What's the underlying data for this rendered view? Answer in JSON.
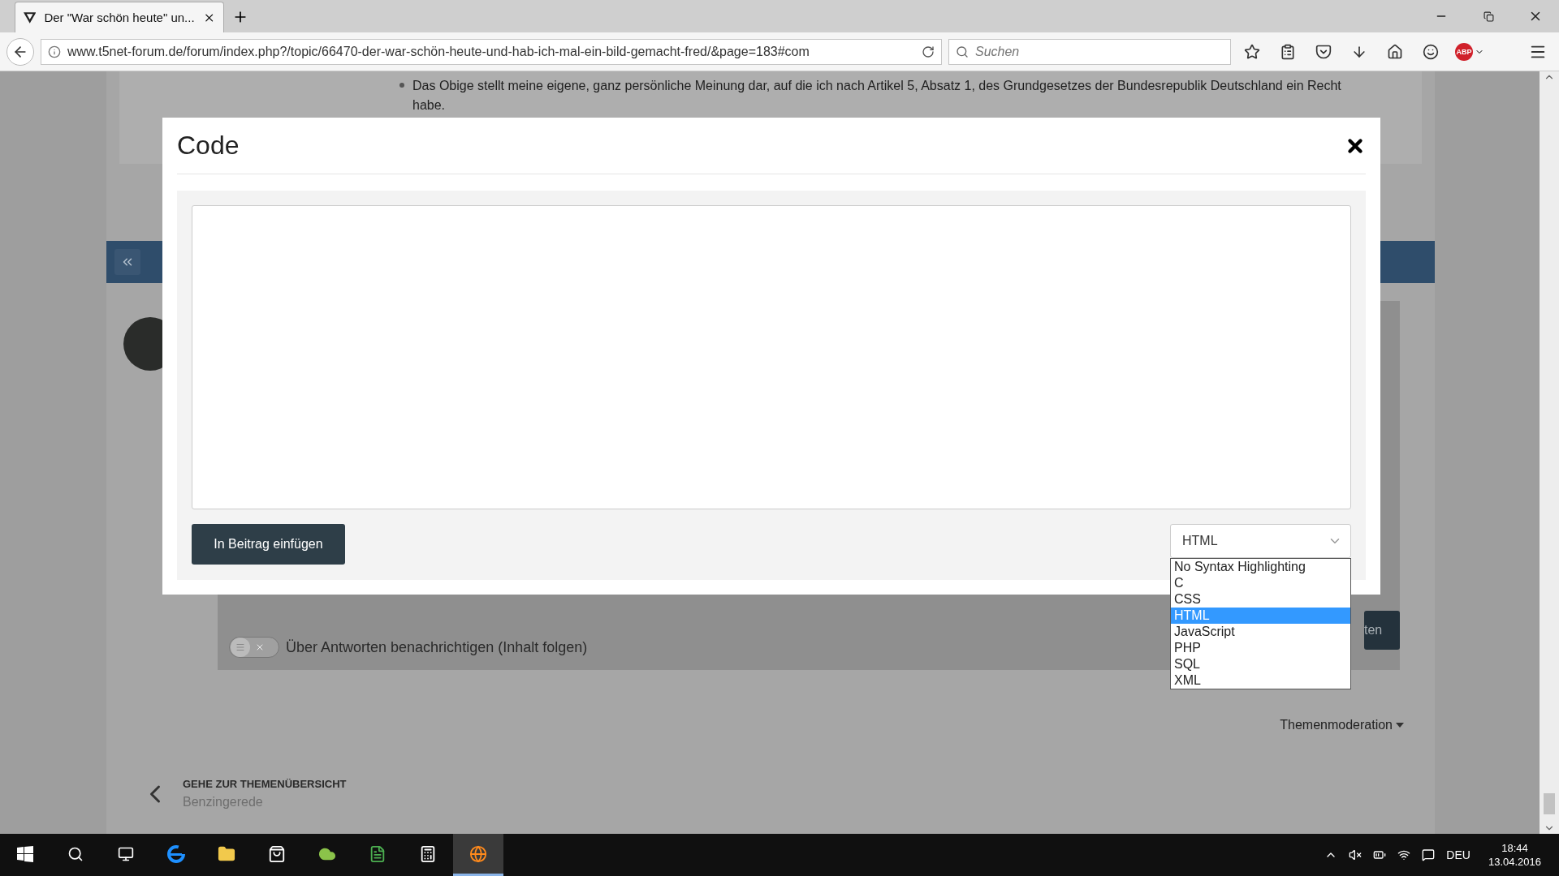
{
  "browser": {
    "tab": {
      "title": "Der \"War schön heute\" un...",
      "selected": true
    },
    "address": "www.t5net-forum.de/forum/index.php?/topic/66470-der-war-schön-heute-und-hab-ich-mal-ein-bild-gemacht-fred/&page=183#com",
    "search": {
      "placeholder": "Suchen"
    },
    "adblock_badge": "ABP"
  },
  "page": {
    "signature_bullet": "Das Obige stellt meine eigene, ganz persönliche Meinung dar, auf die ich nach Artikel 5, Absatz 1, des Grundgesetzes der Bundesrepublik Deutschland ein Recht habe.",
    "notify": {
      "label": "Über Antworten benachrichtigen (Inhalt folgen)",
      "on": false
    },
    "submit_partial": "ten",
    "moderation": "Themenmoderation",
    "back": {
      "title": "GEHE ZUR THEMENÜBERSICHT",
      "subtitle": "Benzingerede"
    }
  },
  "modal": {
    "title": "Code",
    "insert_button": "In Beitrag einfügen",
    "select": {
      "value": "HTML",
      "expanded": true,
      "options": [
        {
          "label": "No Syntax Highlighting",
          "selected": false
        },
        {
          "label": "C",
          "selected": false
        },
        {
          "label": "CSS",
          "selected": false
        },
        {
          "label": "HTML",
          "selected": true
        },
        {
          "label": "JavaScript",
          "selected": false
        },
        {
          "label": "PHP",
          "selected": false
        },
        {
          "label": "SQL",
          "selected": false
        },
        {
          "label": "XML",
          "selected": false
        }
      ]
    }
  },
  "taskbar": {
    "language": "DEU",
    "time": "18:44",
    "date": "13.04.2016"
  }
}
